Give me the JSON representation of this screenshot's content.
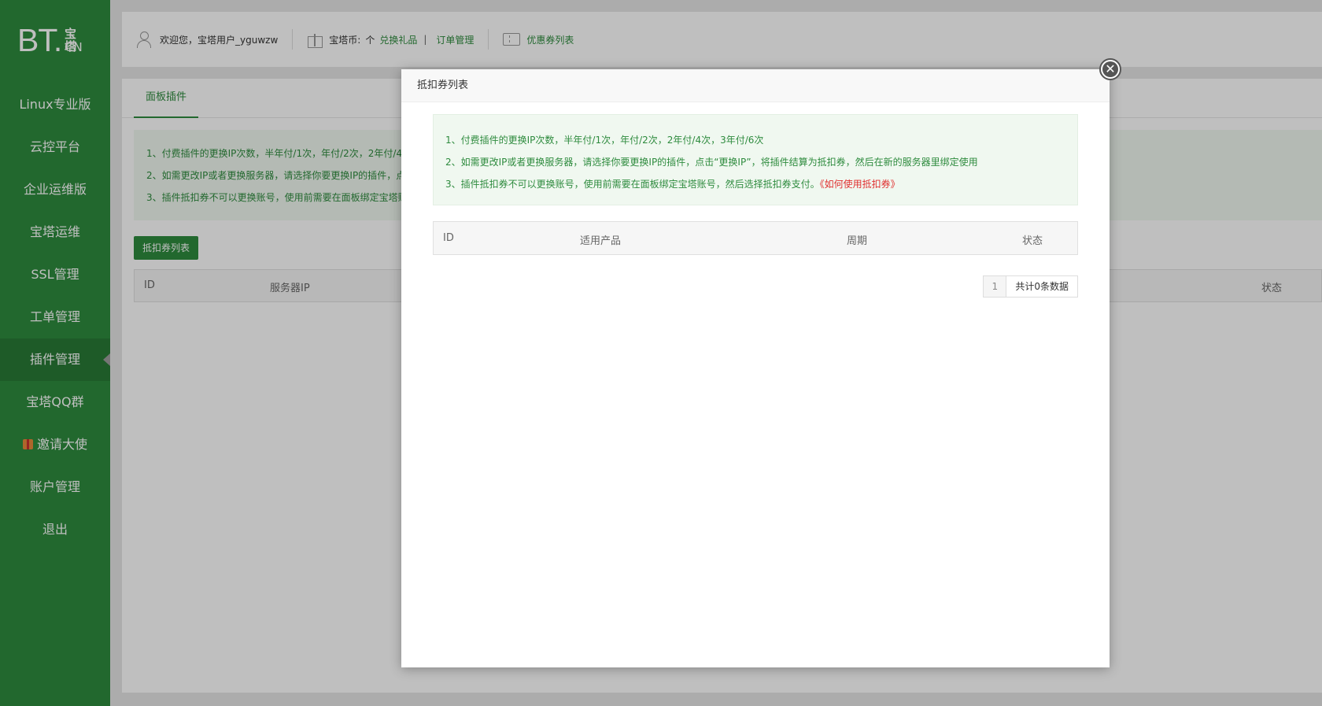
{
  "logo": {
    "main": "BT.",
    "zh": "宝塔",
    "cn": "CN"
  },
  "sidebar": {
    "items": [
      {
        "label": "Linux专业版",
        "active": false
      },
      {
        "label": "云控平台",
        "active": false
      },
      {
        "label": "企业运维版",
        "active": false
      },
      {
        "label": "宝塔运维",
        "active": false
      },
      {
        "label": "SSL管理",
        "active": false
      },
      {
        "label": "工单管理",
        "active": false
      },
      {
        "label": "插件管理",
        "active": true
      },
      {
        "label": "宝塔QQ群",
        "active": false
      },
      {
        "label": "邀请大使",
        "active": false,
        "icon": "gift-icon"
      },
      {
        "label": "账户管理",
        "active": false
      },
      {
        "label": "退出",
        "active": false
      }
    ]
  },
  "topbar": {
    "welcome": "欢迎您，宝塔用户_yguwzw",
    "coins_label": "宝塔币:",
    "coins_value": "个",
    "exchange_gift": "兑换礼品",
    "separator": "|",
    "order_manage": "订单管理",
    "coupon_list": "优惠券列表"
  },
  "panel": {
    "tab": "面板插件",
    "notices": [
      "1、付费插件的更换IP次数，半年付/1次，年付/2次，2年付/4",
      "2、如需更改IP或者更换服务器，请选择你要更换IP的插件，点",
      "3、插件抵扣券不可以更换账号，使用前需要在面板绑定宝塔账"
    ],
    "button": "抵扣券列表",
    "columns": {
      "id": "ID",
      "server_ip": "服务器IP",
      "status": "状态"
    }
  },
  "modal": {
    "title": "抵扣券列表",
    "close_symbol": "✕",
    "notices": {
      "line1": "1、付费插件的更换IP次数，半年付/1次，年付/2次，2年付/4次，3年付/6次",
      "line2": "2、如需更改IP或者更换服务器，请选择你要更换IP的插件，点击“更换IP”，将插件结算为抵扣券，然后在新的服务器里绑定使用",
      "line3": "3、插件抵扣券不可以更换账号，使用前需要在面板绑定宝塔账号，然后选择抵扣券支付。",
      "line3_link": "《如何使用抵扣券》"
    },
    "columns": {
      "id": "ID",
      "product": "适用产品",
      "period": "周期",
      "status": "状态"
    },
    "pager": {
      "page": "1",
      "total": "共计0条数据"
    }
  },
  "colors": {
    "brand_green": "#2e8b3e",
    "link_red": "#e03030",
    "notice_bg": "#f0f8f0"
  }
}
